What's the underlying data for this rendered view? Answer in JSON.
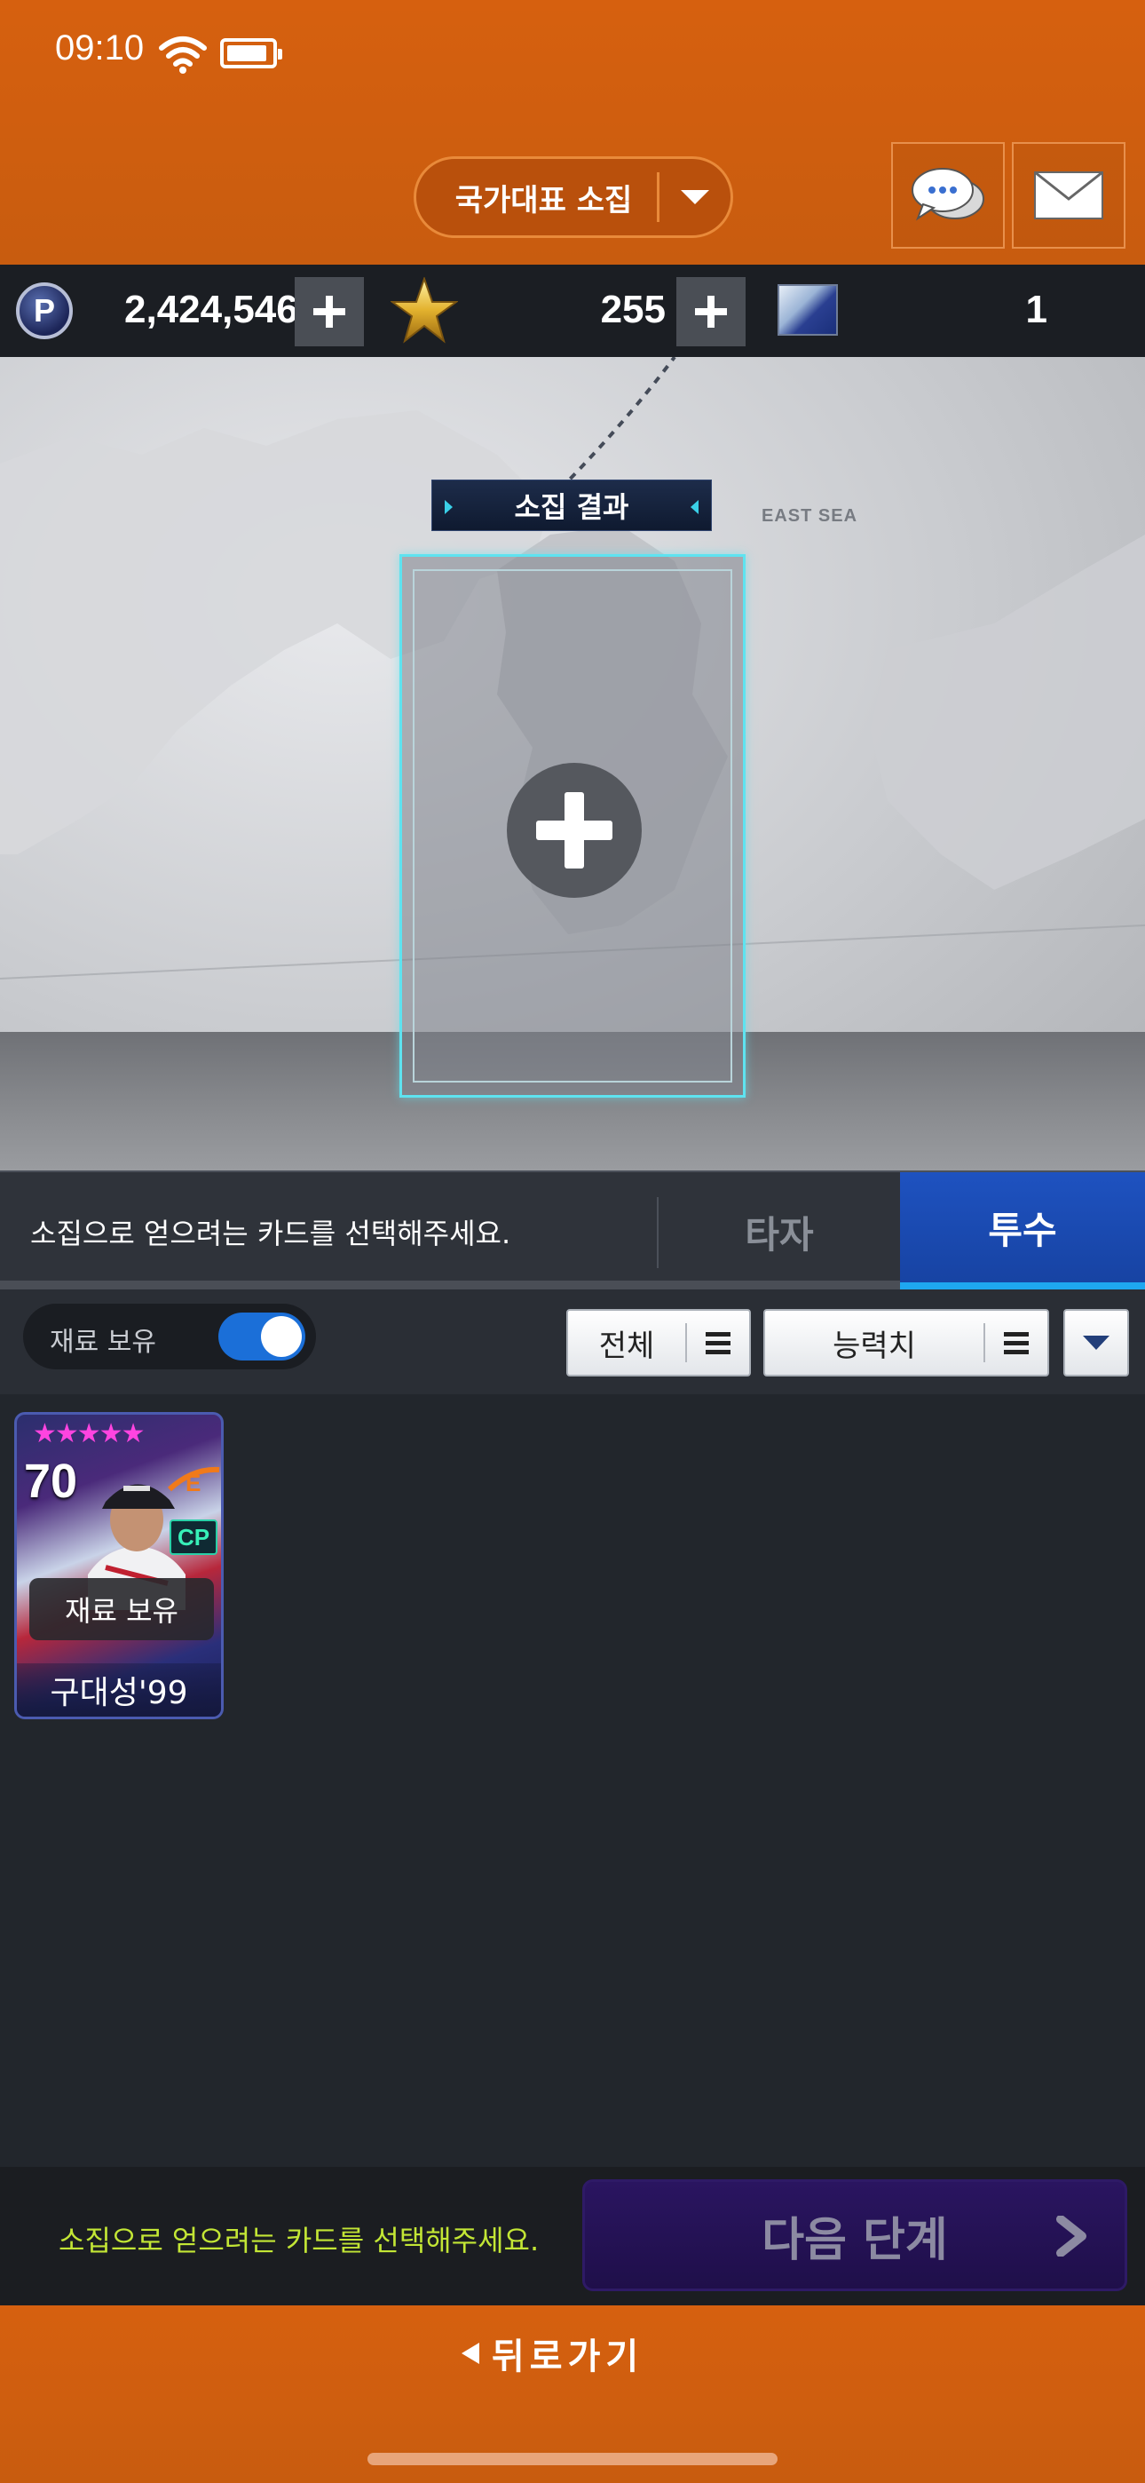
{
  "status_bar": {
    "time": "09:10"
  },
  "header": {
    "mode_dropdown_label": "국가대표 소집"
  },
  "resources": {
    "points": "2,424,546",
    "stars": "255",
    "tickets": "1"
  },
  "map": {
    "sea_label": "EAST SEA",
    "result_title": "소집 결과"
  },
  "tabs": {
    "hint": "소집으로 얻으려는 카드를 선택해주세요.",
    "items": [
      {
        "label": "타자",
        "active": false
      },
      {
        "label": "투수",
        "active": true
      }
    ]
  },
  "filters": {
    "owned_toggle_label": "재료 보유",
    "owned_toggle_on": true,
    "category": "전체",
    "sort_by": "능력치"
  },
  "cards": [
    {
      "name": "구대성'99",
      "rating": "70",
      "stars": 5,
      "badge": "CP",
      "owned_label": "재료 보유"
    }
  ],
  "action_bar": {
    "hint": "소집으로 얻으려는 카드를 선택해주세요.",
    "next_label": "다음 단계"
  },
  "footer": {
    "back_label": "뒤로가기"
  },
  "colors": {
    "brand_orange": "#d6600f",
    "active_tab": "#1e52c0",
    "slot_border": "#5ee3f0",
    "hint_green": "#c3e635"
  }
}
